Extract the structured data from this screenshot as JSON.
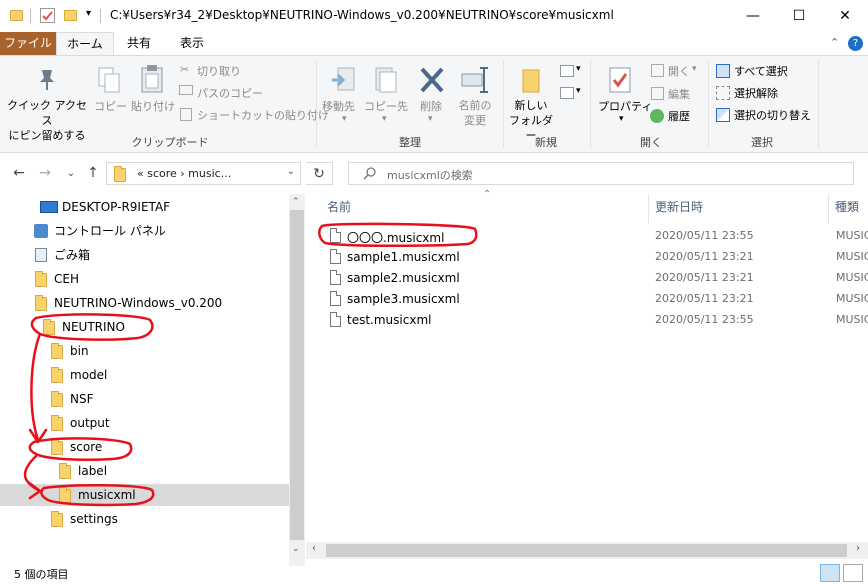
{
  "window": {
    "title": "C:¥Users¥r34_2¥Desktop¥NEUTRINO-Windows_v0.200¥NEUTRINO¥score¥musicxml",
    "controls": {
      "minimize": "—",
      "maximize": "☐",
      "close": "✕"
    },
    "icons": [
      "folder-icon",
      "properties-check-icon",
      "new-folder-icon",
      "customize-dropdown-icon"
    ]
  },
  "ribbon_tabs": {
    "file": "ファイル",
    "home": "ホーム",
    "share": "共有",
    "view": "表示"
  },
  "ribbon": {
    "clipboard": {
      "pin_line1": "クイック アクセス",
      "pin_line2": "にピン留めする",
      "copy": "コピー",
      "paste": "貼り付け",
      "cut": "切り取り",
      "copy_path": "パスのコピー",
      "paste_shortcut": "ショートカットの貼り付け",
      "group_label": "クリップボード"
    },
    "organize": {
      "move_to": "移動先",
      "copy_to": "コピー先",
      "delete": "削除",
      "rename_line1": "名前の",
      "rename_line2": "変更",
      "group_label": "整理"
    },
    "new": {
      "new_folder_line1": "新しい",
      "new_folder_line2": "フォルダー",
      "group_label": "新規"
    },
    "open": {
      "properties": "プロパティ",
      "open": "開く",
      "edit": "編集",
      "history": "履歴",
      "group_label": "開く"
    },
    "select": {
      "select_all": "すべて選択",
      "select_none": "選択解除",
      "invert": "選択の切り替え",
      "group_label": "選択"
    }
  },
  "navigation": {
    "back": "←",
    "forward": "→",
    "history": "⌄",
    "up": "↑",
    "address_text": "«  score  ›  music...",
    "address_dropdown": "⌄",
    "refresh": "↻",
    "search_placeholder": "musicxmlの検索"
  },
  "tree": [
    {
      "label": "DESKTOP-R9IETAF",
      "icon": "computer-icon"
    },
    {
      "label": "コントロール パネル",
      "icon": "control-panel-icon"
    },
    {
      "label": "ごみ箱",
      "icon": "recycle-bin-icon"
    },
    {
      "label": "CEH",
      "icon": "folder-icon"
    },
    {
      "label": "NEUTRINO-Windows_v0.200",
      "icon": "folder-icon"
    },
    {
      "label": "NEUTRINO",
      "icon": "folder-icon"
    },
    {
      "label": "bin",
      "icon": "folder-icon"
    },
    {
      "label": "model",
      "icon": "folder-icon"
    },
    {
      "label": "NSF",
      "icon": "folder-icon"
    },
    {
      "label": "output",
      "icon": "folder-icon"
    },
    {
      "label": "score",
      "icon": "folder-icon"
    },
    {
      "label": "label",
      "icon": "folder-icon"
    },
    {
      "label": "musicxml",
      "icon": "folder-icon",
      "selected": true
    },
    {
      "label": "settings",
      "icon": "folder-icon"
    }
  ],
  "file_list": {
    "columns": {
      "name": "名前",
      "date": "更新日時",
      "type": "種類"
    },
    "rows": [
      {
        "name": "〇〇〇.musicxml",
        "date": "2020/05/11 23:55",
        "type": "MUSICX"
      },
      {
        "name": "sample1.musicxml",
        "date": "2020/05/11 23:21",
        "type": "MUSICX"
      },
      {
        "name": "sample2.musicxml",
        "date": "2020/05/11 23:21",
        "type": "MUSICX"
      },
      {
        "name": "sample3.musicxml",
        "date": "2020/05/11 23:21",
        "type": "MUSICX"
      },
      {
        "name": "test.musicxml",
        "date": "2020/05/11 23:55",
        "type": "MUSICX"
      }
    ]
  },
  "status_bar": {
    "count": "5 個の項目"
  },
  "annotation_color": "#e8101c"
}
